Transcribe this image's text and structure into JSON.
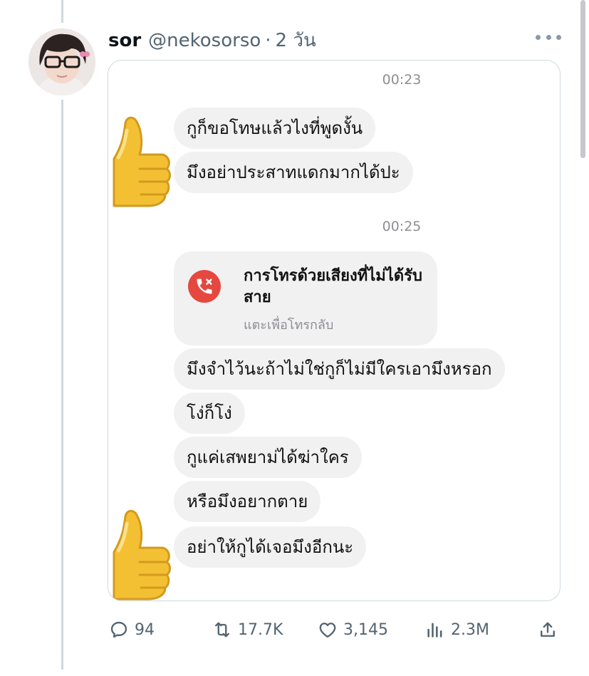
{
  "tweet": {
    "author_name": "sor",
    "handle": "@nekosorso",
    "separator": "·",
    "time": "2 วัน"
  },
  "chat": {
    "timestamps": [
      "00:23",
      "00:25"
    ],
    "messages_before_call": [
      "กูก็ขอโทษแล้วไงที่พูดงั้น",
      "มึงอย่าประสาทแดกมากได้ปะ"
    ],
    "missed_call": {
      "title": "การโทรด้วยเสียงที่ไม่ได้รับสาย",
      "subtitle": "แตะเพื่อโทรกลับ"
    },
    "messages_after_call": [
      "มึงจำไว้นะถ้าไม่ใช่กูก็ไม่มีใครเอามึงหรอก",
      "โง่ก็โง่",
      "กูแค่เสพยาม่ได้ฆ่าใคร",
      "หรือมึงอยากตาย",
      "อย่าให้กูได้เจอมึงอีกนะ"
    ],
    "reactions": [
      "thumbs-up",
      "thumbs-up"
    ]
  },
  "actions": {
    "replies": "94",
    "retweets": "17.7K",
    "likes": "3,145",
    "views": "2.3M"
  },
  "icons": {
    "reply": "speech-bubble-icon",
    "retweet": "retweet-arrows-icon",
    "like": "heart-icon",
    "views": "bar-chart-icon",
    "share": "upload-arrow-icon",
    "missed_call": "phone-x-icon"
  },
  "colors": {
    "text_primary": "#0f1419",
    "text_secondary": "#536471",
    "bubble_bg": "#f1f1f2",
    "missed_call_red": "#e5483f",
    "card_border": "#cfd9de"
  }
}
